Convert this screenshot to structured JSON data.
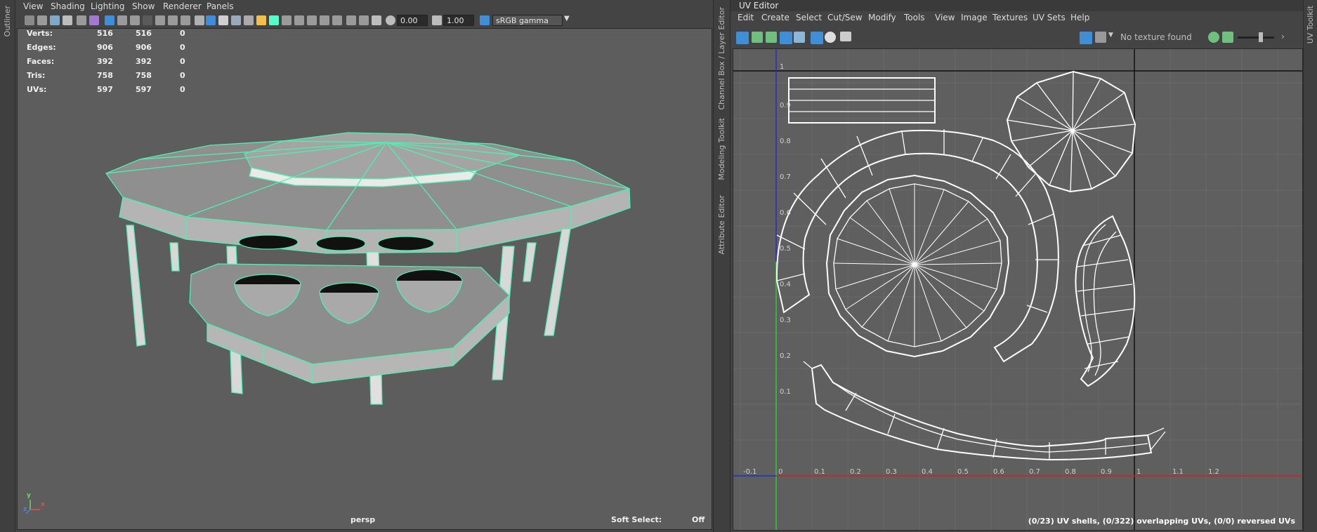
{
  "left_strip": {
    "outliner_tab": "Outliner"
  },
  "viewport_panel": {
    "menu": [
      "View",
      "Shading",
      "Lighting",
      "Show",
      "Renderer",
      "Panels"
    ],
    "toolbar": {
      "exposure_value": "0.00",
      "gamma_value": "1.00",
      "color_space": "sRGB gamma"
    },
    "hud": {
      "rows": [
        {
          "label": "Verts:",
          "a": "516",
          "b": "516",
          "c": "0"
        },
        {
          "label": "Edges:",
          "a": "906",
          "b": "906",
          "c": "0"
        },
        {
          "label": "Faces:",
          "a": "392",
          "b": "392",
          "c": "0"
        },
        {
          "label": "Tris:",
          "a": "758",
          "b": "758",
          "c": "0"
        },
        {
          "label": "UVs:",
          "a": "597",
          "b": "597",
          "c": "0"
        }
      ],
      "camera": "persp",
      "soft_select_label": "Soft Select:",
      "soft_select_value": "Off",
      "axis_y": "y",
      "axis_x": "x",
      "axis_z": "z"
    }
  },
  "mid_strip": {
    "tabs": [
      "Channel Box / Layer Editor",
      "Modeling Toolkit",
      "Attribute Editor"
    ]
  },
  "uv_editor": {
    "title": "UV Editor",
    "menu": [
      "Edit",
      "Create",
      "Select",
      "Cut/Sew",
      "Modify",
      "Tools",
      "View",
      "Image",
      "Textures",
      "UV Sets",
      "Help"
    ],
    "texture_label": "No texture found",
    "v_ticks": [
      "1",
      "0.9",
      "0.8",
      "0.7",
      "0.6",
      "0.5",
      "0.4",
      "0.3",
      "0.2",
      "0.1"
    ],
    "u_ticks": [
      "-0.1",
      "0",
      "0.1",
      "0.2",
      "0.3",
      "0.4",
      "0.5",
      "0.6",
      "0.7",
      "0.8",
      "0.9",
      "1",
      "1.1",
      "1.2"
    ],
    "status": "(0/23) UV shells, (0/322) overlapping UVs, (0/0) reversed UVs"
  },
  "right_strip": {
    "tab": "UV Toolkit"
  },
  "colors": {
    "wire": "#4cf0b4",
    "viewport_bg": "#5d5d5d",
    "uv_bg": "#5f5f5f",
    "accent": "#3f8fd8"
  }
}
